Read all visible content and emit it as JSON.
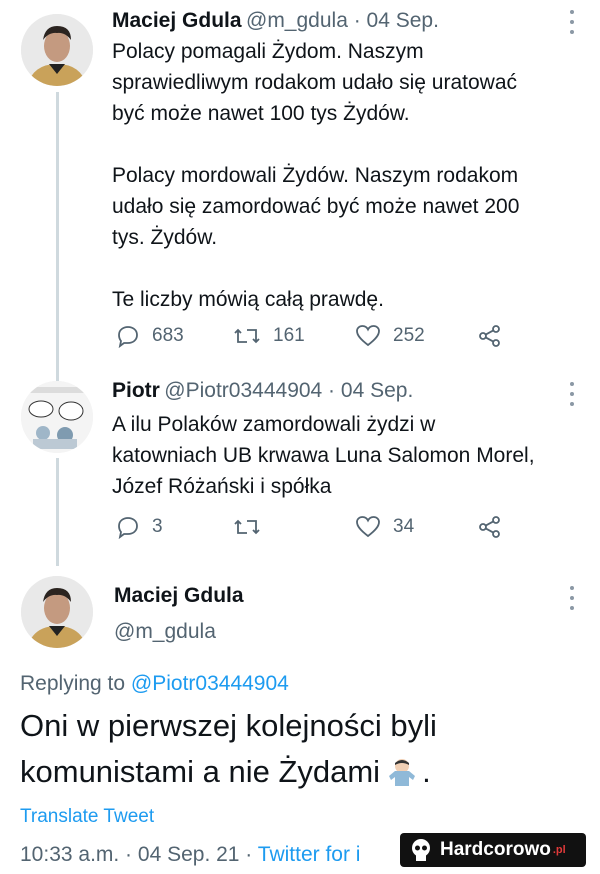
{
  "tweet1": {
    "author_name": "Maciej Gdula",
    "handle_date": "@m_gdula · 04 Sep.",
    "text": "Polacy pomagali Żydom. Naszym\nsprawiedliwym rodakom udało się uratować\nbyć może nawet 100 tys Żydów.\n\nPolacy mordowali Żydów. Naszym rodakom\nudało się zamordować być może nawet 200\ntys. Żydów.\n\nTe liczby mówią całą prawdę.",
    "replies": "683",
    "retweets": "161",
    "likes": "252"
  },
  "tweet2": {
    "author_name": "Piotr",
    "handle_date": "@Piotr03444904 · 04 Sep.",
    "text": "A ilu Polaków zamordowali żydzi w\nkatowniach UB krwawa Luna Salomon Morel,\nJózef Różański i spółka",
    "replies": "3",
    "retweets": "",
    "likes": "34"
  },
  "main_tweet": {
    "author_name": "Maciej Gdula",
    "handle": "@m_gdula",
    "replying_prefix": "Replying to",
    "replying_handle": "@Piotr03444904",
    "text": "Oni w pierwszej kolejności byli\nkomunistami a nie Żydami",
    "text_suffix": ".",
    "translate": "Translate Tweet",
    "timestamp": "10:33 a.m. · 04 Sep. 21 ·",
    "source": "Twitter for i"
  },
  "watermark": {
    "text": "Hardcorowo",
    "suffix": ".pl"
  },
  "colors": {
    "accent": "#1d9bf0",
    "secondary_text": "#536471",
    "thread_line": "#cfd9de"
  },
  "icons": [
    "reply-icon",
    "retweet-icon",
    "like-icon",
    "share-icon",
    "more-icon",
    "shrug-emoji-icon"
  ]
}
